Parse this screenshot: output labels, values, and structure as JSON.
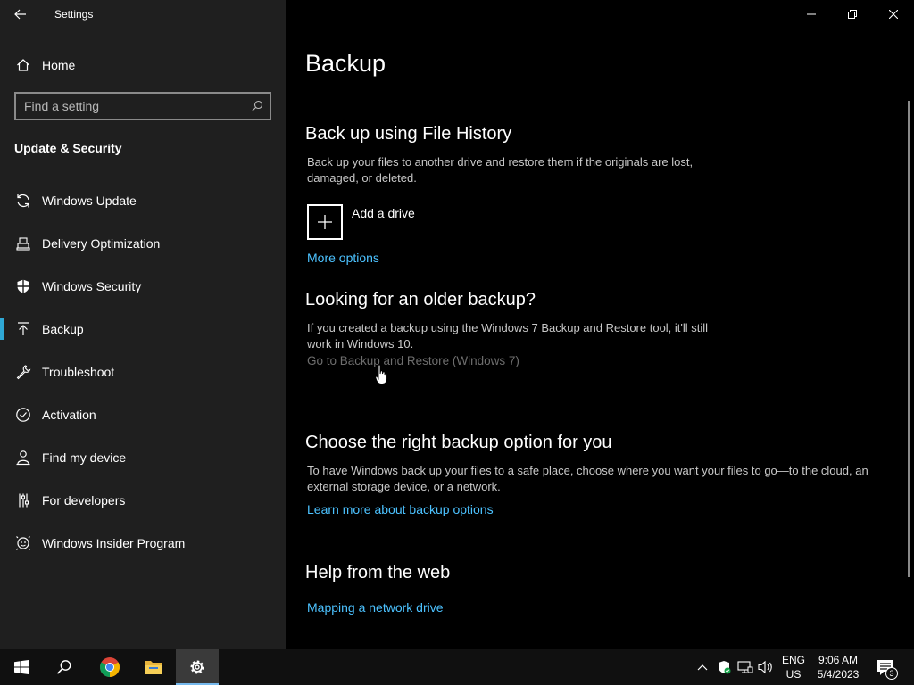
{
  "window": {
    "title": "Settings"
  },
  "sidebar": {
    "home_label": "Home",
    "search_placeholder": "Find a setting",
    "section_title": "Update & Security",
    "items": [
      {
        "label": "Windows Update",
        "icon": "refresh-icon"
      },
      {
        "label": "Delivery Optimization",
        "icon": "delivery-optimization-icon"
      },
      {
        "label": "Windows Security",
        "icon": "shield-icon"
      },
      {
        "label": "Backup",
        "icon": "backup-upload-icon",
        "active": true
      },
      {
        "label": "Troubleshoot",
        "icon": "wrench-icon"
      },
      {
        "label": "Activation",
        "icon": "check-circle-icon"
      },
      {
        "label": "Find my device",
        "icon": "person-location-icon"
      },
      {
        "label": "For developers",
        "icon": "developer-tools-icon"
      },
      {
        "label": "Windows Insider Program",
        "icon": "insider-smiley-icon"
      }
    ]
  },
  "main": {
    "title": "Backup",
    "file_history": {
      "heading": "Back up using File History",
      "description": "Back up your files to another drive and restore them if the originals are lost, damaged, or deleted.",
      "add_drive_label": "Add a drive",
      "more_options_link": "More options"
    },
    "older_backup": {
      "heading": "Looking for an older backup?",
      "description": "If you created a backup using the Windows 7 Backup and Restore tool, it'll still work in Windows 10.",
      "link": "Go to Backup and Restore (Windows 7)"
    },
    "choose_option": {
      "heading": "Choose the right backup option for you",
      "description": "To have Windows back up your files to a safe place, choose where you want your files to go—to the cloud, an external storage device, or a network.",
      "link": "Learn more about backup options"
    },
    "help_web": {
      "heading": "Help from the web",
      "link": "Mapping a network drive"
    }
  },
  "taskbar": {
    "apps": [
      "start-icon",
      "search-icon",
      "chrome-icon",
      "file-explorer-icon",
      "settings-gear-icon"
    ],
    "tray": {
      "lang_top": "ENG",
      "lang_bottom": "US",
      "time": "9:06 AM",
      "date": "5/4/2023",
      "notification_count": "3"
    }
  },
  "colors": {
    "accent": "#2fa8d5",
    "link": "#4cc2ff",
    "sidebar_bg": "#1f1f1f",
    "main_bg": "#000000"
  }
}
